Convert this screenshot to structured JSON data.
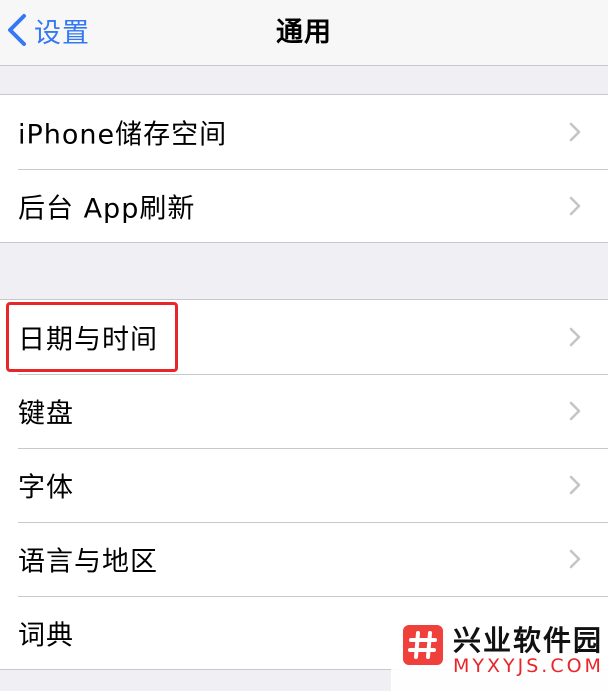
{
  "nav": {
    "back_label": "设置",
    "title": "通用"
  },
  "groups": [
    {
      "items": [
        {
          "label": "iPhone储存空间"
        },
        {
          "label": "后台 App刷新"
        }
      ]
    },
    {
      "items": [
        {
          "label": "日期与时间",
          "highlighted": true
        },
        {
          "label": "键盘"
        },
        {
          "label": "字体"
        },
        {
          "label": "语言与地区"
        },
        {
          "label": "词典"
        }
      ]
    }
  ],
  "colors": {
    "accent": "#3478f6",
    "highlight": "#e8262a",
    "background": "#efeff4"
  },
  "icons": {
    "back": "chevron-left-icon",
    "disclosure": "chevron-right-icon",
    "watermark_logo": "hash-logo-icon"
  },
  "watermark": {
    "title": "兴业软件园",
    "subtitle": "MYXYJS.COM"
  }
}
